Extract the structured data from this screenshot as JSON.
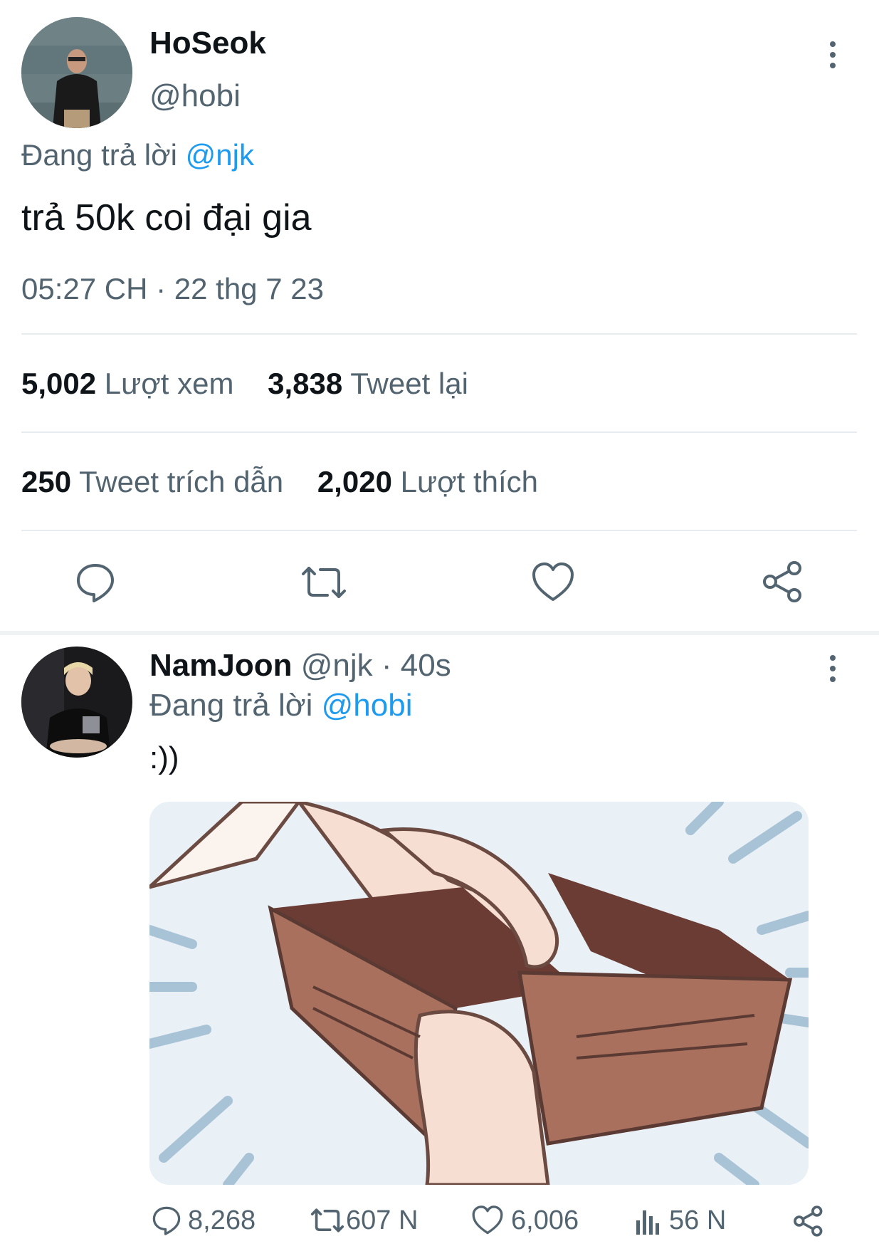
{
  "tweet": {
    "author_name": "HoSeok",
    "author_handle": "@hobi",
    "replying_prefix": "Đang trả lời",
    "replying_to": "@njk",
    "text": "trả 50k coi đại gia",
    "timestamp": "05:27 CH · 22 thg 7 23",
    "stats": {
      "views_count": "5,002",
      "views_label": "Lượt xem",
      "retweets_count": "3,838",
      "retweets_label": "Tweet lại",
      "quotes_count": "250",
      "quotes_label": "Tweet trích dẫn",
      "likes_count": "2,020",
      "likes_label": "Lượt thích"
    },
    "actions": [
      "reply-icon",
      "retweet-icon",
      "like-icon",
      "share-icon"
    ]
  },
  "reply": {
    "author_name": "NamJoon",
    "author_handle": "@njk",
    "time_ago": "· 40s",
    "replying_prefix": "Đang trả lời",
    "replying_to": "@hobi",
    "text": ":))",
    "actions": {
      "reply_count": "8,268",
      "retweet_count": "607 N",
      "like_count": "6,006",
      "views_count": "56 N"
    }
  },
  "colors": {
    "accent": "#1d9bf0",
    "muted": "#536471",
    "divider": "#e6ecf0",
    "wallet": "#a9705e"
  }
}
